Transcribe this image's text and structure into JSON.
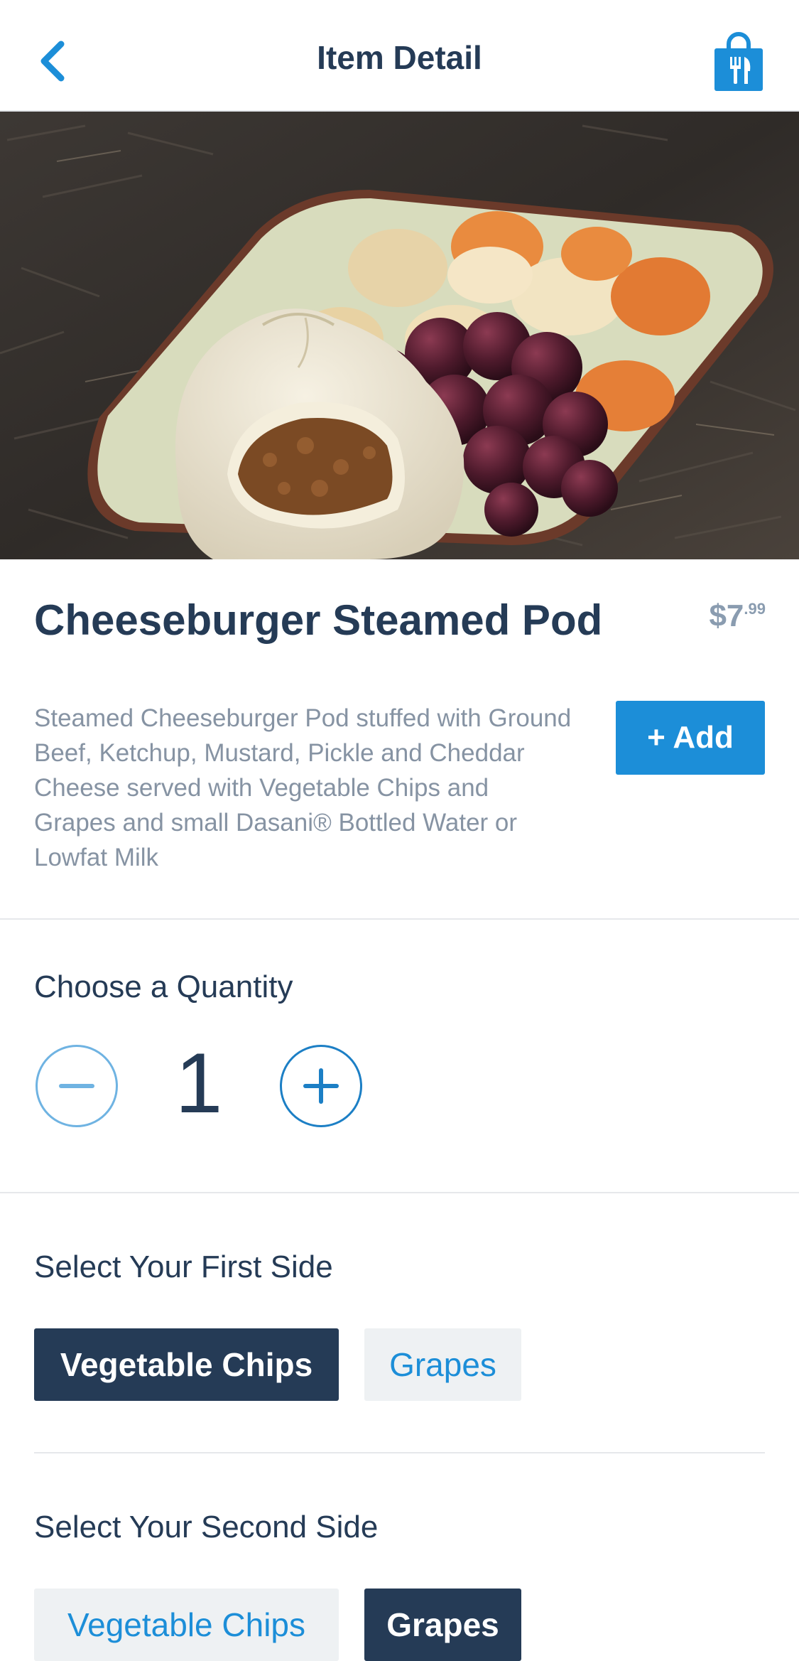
{
  "header": {
    "title": "Item Detail",
    "back_icon": "chevron-left-icon",
    "bag_icon": "shopping-bag-utensils-icon",
    "accent_color": "#1c8ed8"
  },
  "item": {
    "title": "Cheeseburger Steamed Pod",
    "price_dollars": "$7",
    "price_cents": ".99",
    "description": "Steamed Cheeseburger Pod stuffed with Ground Beef, Ketchup, Mustard, Pickle and Cheddar Cheese served with Vegetable Chips and Grapes and small Dasani® Bottled Water or Lowfat Milk",
    "add_label": "+ Add"
  },
  "quantity": {
    "label": "Choose a Quantity",
    "value": "1",
    "minus_icon": "minus-circle-icon",
    "plus_icon": "plus-circle-icon"
  },
  "first_side": {
    "label": "Select Your First Side",
    "options": [
      {
        "label": "Vegetable Chips",
        "selected": true
      },
      {
        "label": "Grapes",
        "selected": false
      }
    ]
  },
  "second_side": {
    "label": "Select Your Second Side",
    "options": [
      {
        "label": "Vegetable Chips",
        "selected": false
      },
      {
        "label": "Grapes",
        "selected": true
      }
    ]
  },
  "colors": {
    "navy": "#253b56",
    "blue": "#1c8ed8",
    "muted_text": "#8693a3",
    "chip_bg": "#eef1f3"
  }
}
